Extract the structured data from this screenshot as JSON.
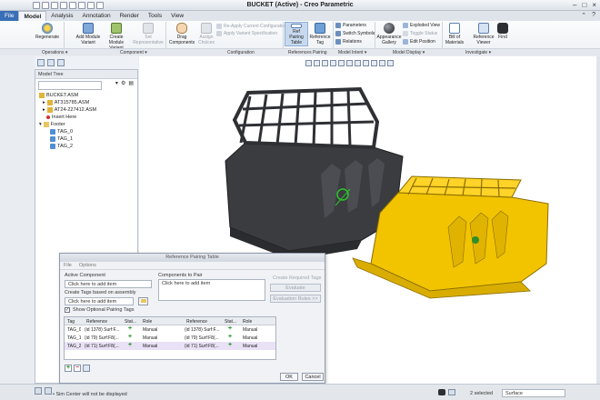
{
  "window": {
    "title": "BUCKET (Active) - Creo Parametric"
  },
  "tabs": [
    "File",
    "Model",
    "Analysis",
    "Annotation",
    "Render",
    "Tools",
    "View"
  ],
  "active_tab": "Model",
  "ribbon": {
    "regenerate": "Regenerate",
    "add_module_variant": "Add Module Variant",
    "create_module_variant": "Create Module Variant",
    "set_representative": "Set Representative",
    "drag_components": "Drag Components",
    "assign_choices": "Assign Choices",
    "re_apply_config": "Re-Apply Current Configuration",
    "apply_variant_spec": "Apply Variant Specification",
    "ref_pairing_table": "Ref Pairing Table",
    "reference_tag": "Reference Tag",
    "parameters": "Parameters",
    "switch_symbols": "Switch Symbols",
    "relations": "Relations",
    "appearance_gallery": "Appearance Gallery",
    "exploded_view": "Exploded View",
    "toggle_status": "Toggle Status",
    "edit_position": "Edit Position",
    "bill_of_materials": "Bill of Materials",
    "reference_viewer": "Reference Viewer",
    "find": "Find"
  },
  "groups": {
    "operations": "Operations ▾",
    "component": "Component ▾",
    "configuration": "Configuration",
    "references_pairing": "References Pairing",
    "model_intent": "Model Intent ▾",
    "model_display": "Model Display ▾",
    "investigate": "Investigate ▾"
  },
  "model_tree": {
    "header": "Model Tree",
    "items": [
      "BUCKET.ASM",
      "AT315785.ASM",
      "AT24-227412.ASM",
      "Insert Here",
      "Footer",
      "TAG_0",
      "TAG_1",
      "TAG_2"
    ]
  },
  "dialog": {
    "title": "Reference Pairing Table",
    "menu": [
      "File",
      "Options"
    ],
    "active_component_label": "Active Component",
    "active_component_value": "Click here to add item",
    "create_tags_label": "Create Tags based on assembly",
    "create_tags_value": "Click here to add item",
    "components_to_pair_label": "Components to Pair",
    "components_to_pair_value": "Click here to add item",
    "create_required_tags": "Create Required Tags",
    "evaluate": "Evaluate",
    "evaluation_rules": "Evaluation Rules >>",
    "show_optional_label": "Show Optional Pairing Tags",
    "columns": [
      "Tag",
      "Reference",
      "Stat...",
      "Role",
      "Reference",
      "Stat...",
      "Role"
    ],
    "rows": [
      [
        "TAG_0",
        "(id 1378) Surf:F...",
        "+",
        "Manual",
        "(id 1378) Surf:F...",
        "+",
        "Manual"
      ],
      [
        "TAG_1",
        "(id 79) Surf:F8(...",
        "+",
        "Manual",
        "(id 79) Surf:F8(...",
        "+",
        "Manual"
      ],
      [
        "TAG_2",
        "(id 71) Surf:F8(...",
        "+",
        "Manual",
        "(id 71) Surf:F8(...",
        "+",
        "Manual"
      ]
    ],
    "ok": "OK",
    "cancel": "Cancel"
  },
  "status": {
    "message": "• Sim Center will not be displayed",
    "selected": "2 selected",
    "filter": "Surface"
  },
  "colors": {
    "accent": "#3a6fb7",
    "bucket_dark": "#3c3d40",
    "bucket_yellow": "#f2c400"
  }
}
